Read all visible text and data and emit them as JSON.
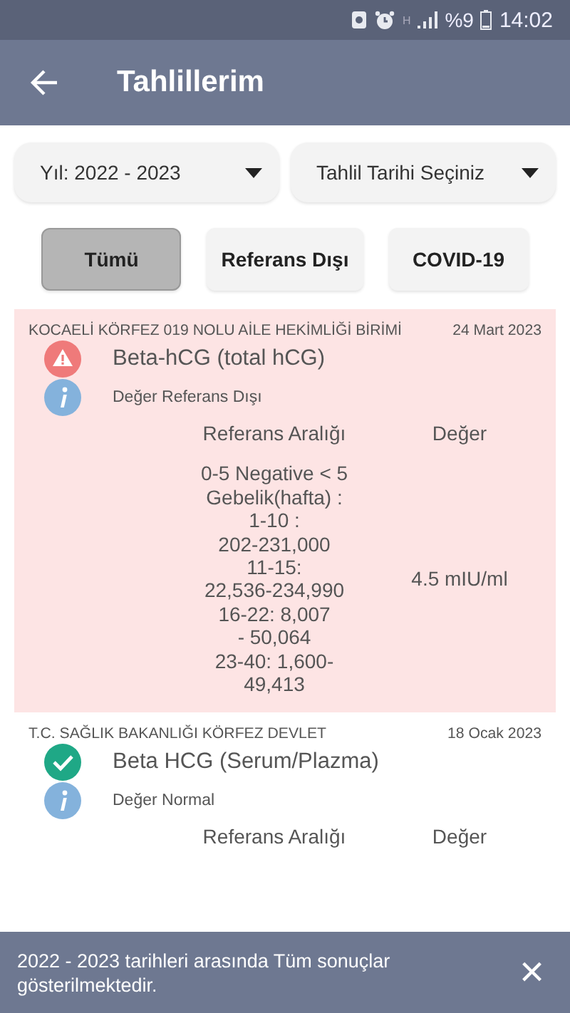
{
  "status_bar": {
    "network": "H",
    "battery": "%9",
    "time": "14:02"
  },
  "app_bar": {
    "title": "Tahlillerim"
  },
  "filters": [
    {
      "label": "Yıl: 2022 - 2023"
    },
    {
      "label": "Tahlil Tarihi Seçiniz"
    }
  ],
  "chips": [
    {
      "label": "Tümü",
      "selected": true
    },
    {
      "label": "Referans Dışı",
      "selected": false
    },
    {
      "label": "COVID-19",
      "selected": false
    }
  ],
  "results": [
    {
      "kind": "warning",
      "facility": "KOCAELİ KÖRFEZ 019 NOLU AİLE HEKİMLİĞİ BİRİMİ",
      "date": "24 Mart 2023",
      "test": "Beta-hCG (total hCG)",
      "note": "Değer Referans Dışı",
      "range_header": "Referans Aralığı",
      "value_header": "Değer",
      "range": "0-5  Negative < 5\nGebelik(hafta) :\n1-10 :\n202-231,000\n11-15:\n22,536-234,990\n16-22:  8,007\n-  50,064\n23-40:  1,600-\n49,413",
      "value": "4.5 mIU/ml"
    },
    {
      "kind": "normal",
      "facility": "T.C. SAĞLIK BAKANLIĞI KÖRFEZ DEVLET",
      "date": "18 Ocak 2023",
      "test": "Beta HCG (Serum/Plazma)",
      "note": "Değer Normal",
      "range_header": "Referans Aralığı",
      "value_header": "Değer"
    }
  ],
  "snackbar": {
    "message": "2022 - 2023 tarihleri arasında Tüm sonuçlar gösterilmektedir.",
    "close": "×"
  }
}
